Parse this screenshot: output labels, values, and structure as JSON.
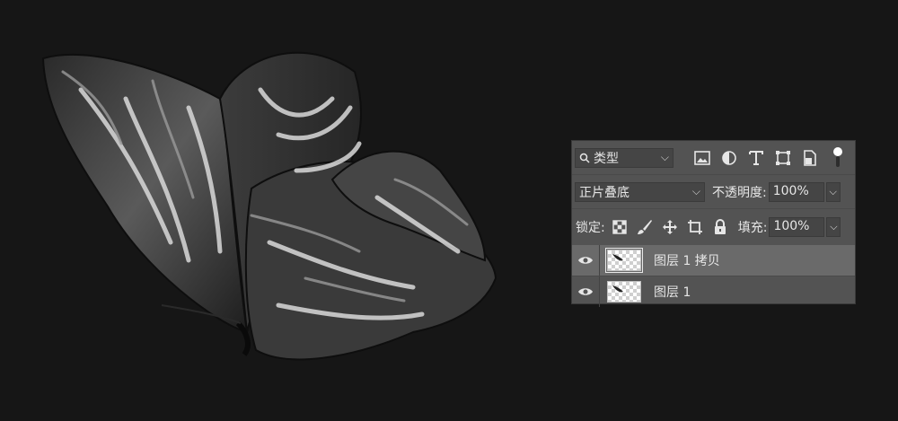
{
  "layers_panel": {
    "filter": {
      "label": "类型",
      "icon": "search-icon",
      "chevron": "⌵"
    },
    "blend_mode": {
      "value": "正片叠底",
      "chevron": "⌵"
    },
    "opacity": {
      "label": "不透明度:",
      "value": "100%",
      "chevron": "⌵"
    },
    "lock": {
      "label": "锁定:"
    },
    "fill": {
      "label": "填充:",
      "value": "100%",
      "chevron": "⌵"
    },
    "layers": [
      {
        "name": "图层 1 拷贝",
        "visible": true,
        "selected": true
      },
      {
        "name": "图层 1",
        "visible": true,
        "selected": false
      }
    ]
  },
  "colors": {
    "app_bg": "#161616",
    "panel_bg": "#535353",
    "selected_row": "#6a6a6a"
  }
}
